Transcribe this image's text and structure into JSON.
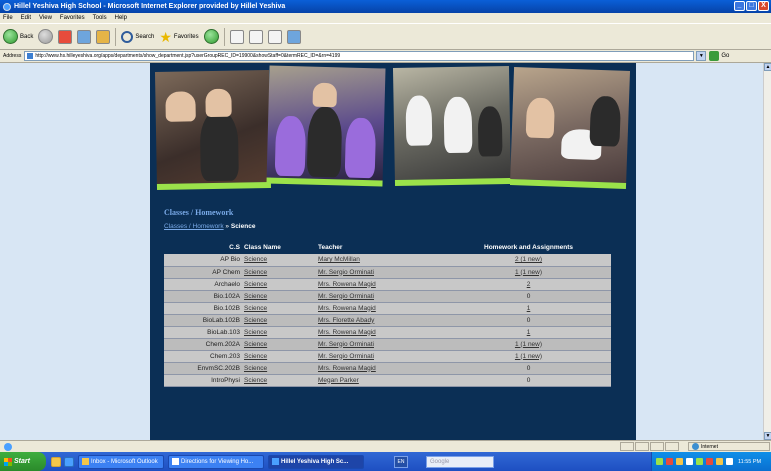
{
  "window": {
    "title": "Hillel Yeshiva High School - Microsoft Internet Explorer provided by Hillel Yeshiva",
    "controls": [
      "_",
      "□",
      "X"
    ]
  },
  "menu": [
    "File",
    "Edit",
    "View",
    "Favorites",
    "Tools",
    "Help"
  ],
  "toolbar": {
    "back_label": "Back",
    "search_label": "Search",
    "favorites_label": "Favorites"
  },
  "address": {
    "label": "Address",
    "url": "http://www.hs.hilleyeshiva.org/apps/departments/show_department.jsp?userGroupREC_ID=19900&showStaff=0&termREC_ID=&rn=4199",
    "go_label": "Go"
  },
  "page": {
    "section_title": "Classes / Homework",
    "breadcrumb": {
      "link": "Classes / Homework",
      "separator": "»",
      "current": "Science"
    },
    "table": {
      "headers": {
        "cs": "C.S",
        "class_name": "Class Name",
        "teacher": "Teacher",
        "homework": "Homework and Assignments"
      },
      "rows": [
        {
          "cs": "AP Bio",
          "class_name": "Science",
          "teacher": "Mary McMillan",
          "homework": "2 (1 new)",
          "hw_link": true
        },
        {
          "cs": "AP Chem",
          "class_name": "Science",
          "teacher": "Mr. Sergio Orminati",
          "homework": "1 (1 new)",
          "hw_link": true
        },
        {
          "cs": "Archaelo",
          "class_name": "Science",
          "teacher": "Mrs. Rowena Magid",
          "homework": "2",
          "hw_link": true
        },
        {
          "cs": "Bio.102A",
          "class_name": "Science",
          "teacher": "Mr. Sergio Orminati",
          "homework": "0",
          "hw_link": false
        },
        {
          "cs": "Bio.102B",
          "class_name": "Science",
          "teacher": "Mrs. Rowena Magid",
          "homework": "1",
          "hw_link": true
        },
        {
          "cs": "BioLab.102B",
          "class_name": "Science",
          "teacher": "Mrs. Florette Abady",
          "homework": "0",
          "hw_link": false
        },
        {
          "cs": "BioLab.103",
          "class_name": "Science",
          "teacher": "Mrs. Rowena Magid",
          "homework": "1",
          "hw_link": true
        },
        {
          "cs": "Chem.202A",
          "class_name": "Science",
          "teacher": "Mr. Sergio Orminati",
          "homework": "1 (1 new)",
          "hw_link": true
        },
        {
          "cs": "Chem.203",
          "class_name": "Science",
          "teacher": "Mr. Sergio Orminati",
          "homework": "1 (1 new)",
          "hw_link": true
        },
        {
          "cs": "EnvmSC.202B",
          "class_name": "Science",
          "teacher": "Mrs. Rowena Magid",
          "homework": "0",
          "hw_link": false
        },
        {
          "cs": "IntroPhysi",
          "class_name": "Science",
          "teacher": "Megan Parker",
          "homework": "0",
          "hw_link": false
        }
      ]
    }
  },
  "statusbar": {
    "zone": "Internet"
  },
  "taskbar": {
    "start_label": "Start",
    "tasks": [
      {
        "label": "Inbox - Microsoft Outlook",
        "icon": "outlook-icon",
        "active": false
      },
      {
        "label": "Directions for Viewing Ho...",
        "icon": "word-icon",
        "active": false
      },
      {
        "label": "Hillel Yeshiva High Sc...",
        "icon": "ie-icon",
        "active": true
      }
    ],
    "language": "EN",
    "search_placeholder": "Google",
    "clock": "11:55 PM"
  },
  "colors": {
    "site_bg": "#0b2f55",
    "link_blue": "#7aaae8",
    "row_bg": "#c8c8c8",
    "photo_border": "#9be24a",
    "page_bg": "#d8e6f4"
  }
}
